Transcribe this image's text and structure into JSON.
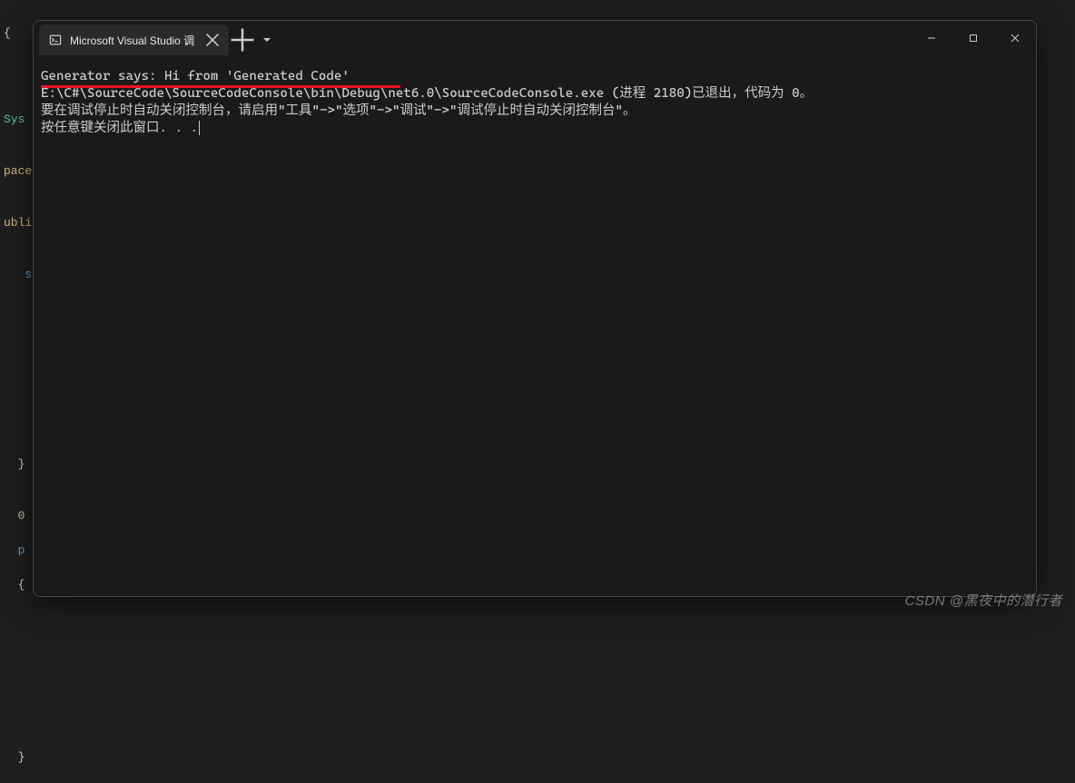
{
  "background": {
    "lines": [
      "{",
      "",
      "",
      "",
      "Sys",
      "",
      "pace",
      "",
      "ubli",
      "",
      "   s",
      "",
      "",
      "",
      "",
      "",
      "",
      "",
      "",
      "",
      "  }",
      "",
      "  0",
      "  p",
      "  {",
      "",
      "",
      "",
      "",
      "",
      "",
      "",
      "",
      "  }"
    ]
  },
  "window": {
    "tab_title": "Microsoft Visual Studio 调",
    "tab_icon": "terminal-icon"
  },
  "console": {
    "line1": "Generator says: Hi from 'Generated Code'",
    "blank": "",
    "line2": "E:\\C#\\SourceCode\\SourceCodeConsole\\bin\\Debug\\net6.0\\SourceCodeConsole.exe (进程 2180)已退出，代码为 0。",
    "line3": "要在调试停止时自动关闭控制台，请启用\"工具\"->\"选项\"->\"调试\"->\"调试停止时自动关闭控制台\"。",
    "line4": "按任意键关闭此窗口. . ."
  },
  "watermark": "CSDN @黑夜中的潜行者"
}
